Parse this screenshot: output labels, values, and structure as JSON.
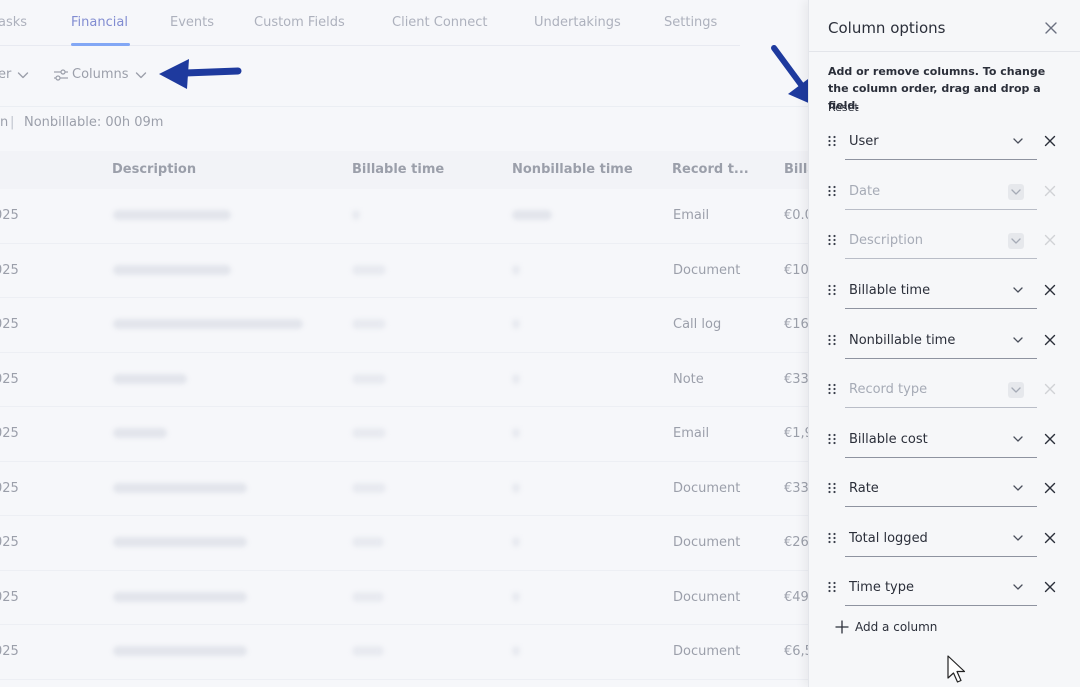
{
  "tabs": [
    {
      "label": "asks",
      "active": false
    },
    {
      "label": "Financial",
      "active": true
    },
    {
      "label": "Events",
      "active": false
    },
    {
      "label": "Custom Fields",
      "active": false
    },
    {
      "label": "Client Connect",
      "active": false
    },
    {
      "label": "Undertakings",
      "active": false
    },
    {
      "label": "Settings",
      "active": false
    }
  ],
  "toolbar": {
    "filter_label": "er",
    "columns_label": "Columns",
    "columns_icon": "sliders-icon"
  },
  "summary": {
    "prefix": "n",
    "separator": "|",
    "nonbillable": "Nonbillable: 00h 09m"
  },
  "table": {
    "columns": [
      "Description",
      "Billable time",
      "Nonbillable time",
      "Record t...",
      "Billa"
    ],
    "rows": [
      {
        "date": "025",
        "record_type": "Email",
        "billable_cost": "€0.0"
      },
      {
        "date": "025",
        "record_type": "Document",
        "billable_cost": "€10"
      },
      {
        "date": "025",
        "record_type": "Call log",
        "billable_cost": "€16"
      },
      {
        "date": "025",
        "record_type": "Note",
        "billable_cost": "€33"
      },
      {
        "date": "025",
        "record_type": "Email",
        "billable_cost": "€1,9"
      },
      {
        "date": "025",
        "record_type": "Document",
        "billable_cost": "€33"
      },
      {
        "date": "025",
        "record_type": "Document",
        "billable_cost": "€26"
      },
      {
        "date": "025",
        "record_type": "Document",
        "billable_cost": "€49"
      },
      {
        "date": "025",
        "record_type": "Document",
        "billable_cost": "€6,5"
      }
    ]
  },
  "panel": {
    "title": "Column options",
    "description": "Add or remove columns. To change the column order, drag and drop a field.",
    "reset_label": "Reset",
    "add_column_label": "Add a column",
    "columns": [
      {
        "label": "User",
        "disabled": false
      },
      {
        "label": "Date",
        "disabled": true
      },
      {
        "label": "Description",
        "disabled": true
      },
      {
        "label": "Billable time",
        "disabled": false
      },
      {
        "label": "Nonbillable time",
        "disabled": false
      },
      {
        "label": "Record type",
        "disabled": true
      },
      {
        "label": "Billable cost",
        "disabled": false
      },
      {
        "label": "Rate",
        "disabled": false
      },
      {
        "label": "Total logged",
        "disabled": false
      },
      {
        "label": "Time type",
        "disabled": false
      }
    ]
  },
  "colors": {
    "accent": "#2d6df6",
    "active_tab": "#2a3cb5",
    "annotation_arrow": "#1e3a9e"
  }
}
